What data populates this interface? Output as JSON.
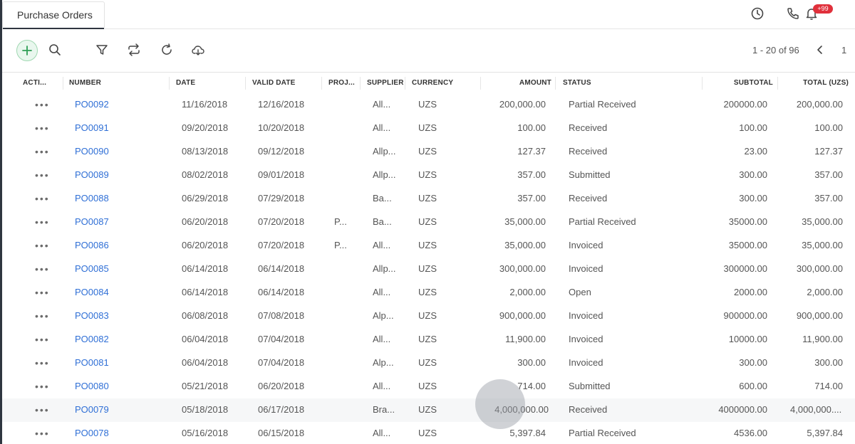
{
  "header": {
    "tab_label": "Purchase Orders",
    "notification_badge": "+99",
    "icons": [
      "history-icon",
      "phone-icon",
      "bell-icon"
    ]
  },
  "toolbar": {
    "icons": [
      "plus-icon",
      "search-icon",
      "filter-icon",
      "repeat-icon",
      "refresh-icon",
      "cloud-download-icon"
    ],
    "pager_text": "1 - 20 of 96",
    "current_page": "1"
  },
  "columns": [
    "ACTI...",
    "NUMBER",
    "DATE",
    "VALID DATE",
    "PROJ...",
    "SUPPLIER",
    "CURRENCY",
    "AMOUNT",
    "STATUS",
    "SUBTOTAL",
    "TOTAL (UZS)"
  ],
  "rows": [
    {
      "actions": "•••",
      "number": "PO0092",
      "date": "11/16/2018",
      "valid_date": "12/16/2018",
      "project": "",
      "supplier": "All...",
      "currency": "UZS",
      "amount": "200,000.00",
      "status": "Partial Received",
      "subtotal": "200000.00",
      "total": "200,000.00"
    },
    {
      "actions": "•••",
      "number": "PO0091",
      "date": "09/20/2018",
      "valid_date": "10/20/2018",
      "project": "",
      "supplier": "All...",
      "currency": "UZS",
      "amount": "100.00",
      "status": "Received",
      "subtotal": "100.00",
      "total": "100.00"
    },
    {
      "actions": "•••",
      "number": "PO0090",
      "date": "08/13/2018",
      "valid_date": "09/12/2018",
      "project": "",
      "supplier": "Allp...",
      "currency": "UZS",
      "amount": "127.37",
      "status": "Received",
      "subtotal": "23.00",
      "total": "127.37"
    },
    {
      "actions": "•••",
      "number": "PO0089",
      "date": "08/02/2018",
      "valid_date": "09/01/2018",
      "project": "",
      "supplier": "Allp...",
      "currency": "UZS",
      "amount": "357.00",
      "status": "Submitted",
      "subtotal": "300.00",
      "total": "357.00"
    },
    {
      "actions": "•••",
      "number": "PO0088",
      "date": "06/29/2018",
      "valid_date": "07/29/2018",
      "project": "",
      "supplier": "Ba...",
      "currency": "UZS",
      "amount": "357.00",
      "status": "Received",
      "subtotal": "300.00",
      "total": "357.00"
    },
    {
      "actions": "•••",
      "number": "PO0087",
      "date": "06/20/2018",
      "valid_date": "07/20/2018",
      "project": "P...",
      "supplier": "Ba...",
      "currency": "UZS",
      "amount": "35,000.00",
      "status": "Partial Received",
      "subtotal": "35000.00",
      "total": "35,000.00"
    },
    {
      "actions": "•••",
      "number": "PO0086",
      "date": "06/20/2018",
      "valid_date": "07/20/2018",
      "project": "P...",
      "supplier": "All...",
      "currency": "UZS",
      "amount": "35,000.00",
      "status": "Invoiced",
      "subtotal": "35000.00",
      "total": "35,000.00"
    },
    {
      "actions": "•••",
      "number": "PO0085",
      "date": "06/14/2018",
      "valid_date": "06/14/2018",
      "project": "",
      "supplier": "Allp...",
      "currency": "UZS",
      "amount": "300,000.00",
      "status": "Invoiced",
      "subtotal": "300000.00",
      "total": "300,000.00"
    },
    {
      "actions": "•••",
      "number": "PO0084",
      "date": "06/14/2018",
      "valid_date": "06/14/2018",
      "project": "",
      "supplier": "All...",
      "currency": "UZS",
      "amount": "2,000.00",
      "status": "Open",
      "subtotal": "2000.00",
      "total": "2,000.00"
    },
    {
      "actions": "•••",
      "number": "PO0083",
      "date": "06/08/2018",
      "valid_date": "07/08/2018",
      "project": "",
      "supplier": "Alp...",
      "currency": "UZS",
      "amount": "900,000.00",
      "status": "Invoiced",
      "subtotal": "900000.00",
      "total": "900,000.00"
    },
    {
      "actions": "•••",
      "number": "PO0082",
      "date": "06/04/2018",
      "valid_date": "07/04/2018",
      "project": "",
      "supplier": "All...",
      "currency": "UZS",
      "amount": "11,900.00",
      "status": "Invoiced",
      "subtotal": "10000.00",
      "total": "11,900.00"
    },
    {
      "actions": "•••",
      "number": "PO0081",
      "date": "06/04/2018",
      "valid_date": "07/04/2018",
      "project": "",
      "supplier": "Alp...",
      "currency": "UZS",
      "amount": "300.00",
      "status": "Invoiced",
      "subtotal": "300.00",
      "total": "300.00"
    },
    {
      "actions": "•••",
      "number": "PO0080",
      "date": "05/21/2018",
      "valid_date": "06/20/2018",
      "project": "",
      "supplier": "All...",
      "currency": "UZS",
      "amount": "714.00",
      "status": "Submitted",
      "subtotal": "600.00",
      "total": "714.00"
    },
    {
      "actions": "•••",
      "number": "PO0079",
      "date": "05/18/2018",
      "valid_date": "06/17/2018",
      "project": "",
      "supplier": "Bra...",
      "currency": "UZS",
      "amount": "4,000,000.00",
      "status": "Received",
      "subtotal": "4000000.00",
      "total": "4,000,000...."
    },
    {
      "actions": "•••",
      "number": "PO0078",
      "date": "05/16/2018",
      "valid_date": "06/15/2018",
      "project": "",
      "supplier": "All...",
      "currency": "UZS",
      "amount": "5,397.84",
      "status": "Partial Received",
      "subtotal": "4536.00",
      "total": "5,397.84"
    }
  ]
}
